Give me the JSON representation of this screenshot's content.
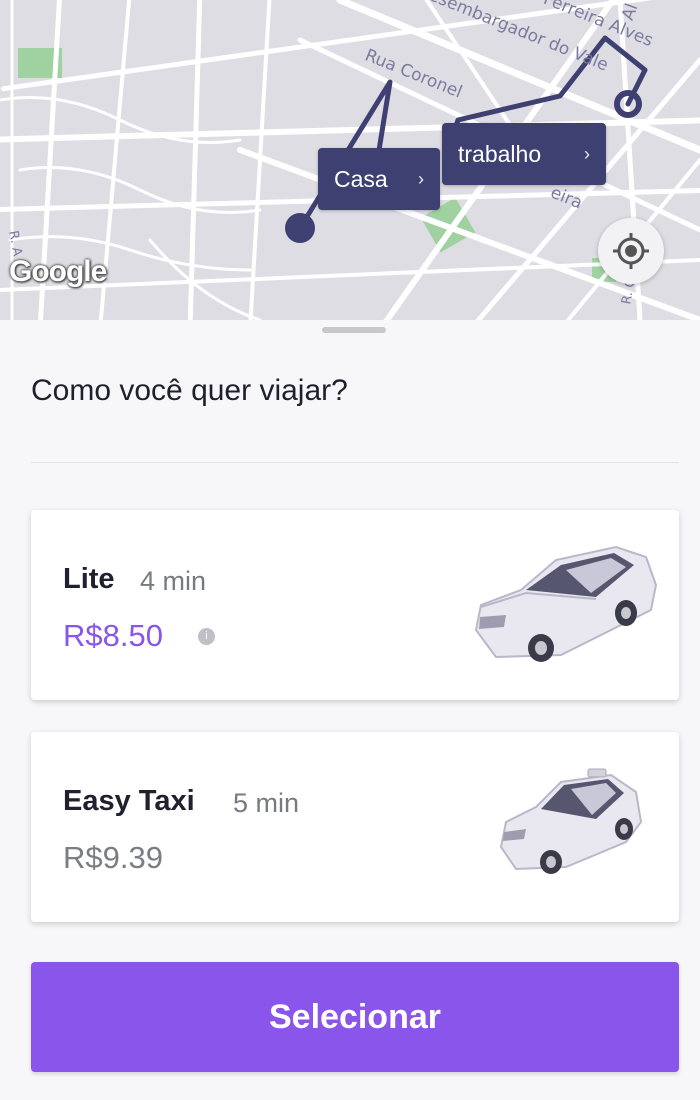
{
  "map": {
    "attribution": "Google",
    "street_labels": [
      "Desembargador do Vale",
      "Rua Coronel",
      "Ferreira Alves",
      "Al",
      "eira",
      "R. A",
      "R. C"
    ],
    "pins": {
      "origin_label": "Casa",
      "destination_label": "trabalho"
    },
    "locate_icon": "crosshair-icon"
  },
  "sheet": {
    "question": "Como você quer viajar?",
    "options": [
      {
        "name": "Lite",
        "eta": "4 min",
        "price": "R$8.50",
        "price_color": "#8a55ea",
        "selected": true,
        "icon": "sedan-car-icon"
      },
      {
        "name": "Easy Taxi",
        "eta": "5 min",
        "price": "R$9.39",
        "price_color": "#7b7d82",
        "selected": false,
        "icon": "taxi-hatchback-icon"
      }
    ],
    "select_button": "Selecionar"
  },
  "colors": {
    "accent": "#8a55ea",
    "route": "#3f4072"
  }
}
